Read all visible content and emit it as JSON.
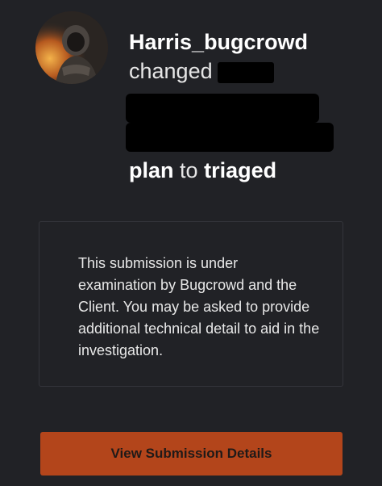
{
  "activity": {
    "username": "Harris_bugcrowd",
    "action": "changed",
    "from_status_end": "plan",
    "connector": "to",
    "to_status": "triaged"
  },
  "message": {
    "body": "This submission is under examination by Bugcrowd and the Client. You may be asked to provide additional technical detail to aid in the investigation."
  },
  "cta": {
    "label": "View Submission Details"
  },
  "colors": {
    "background": "#212226",
    "cta": "#b3451b",
    "border": "#34353b"
  }
}
